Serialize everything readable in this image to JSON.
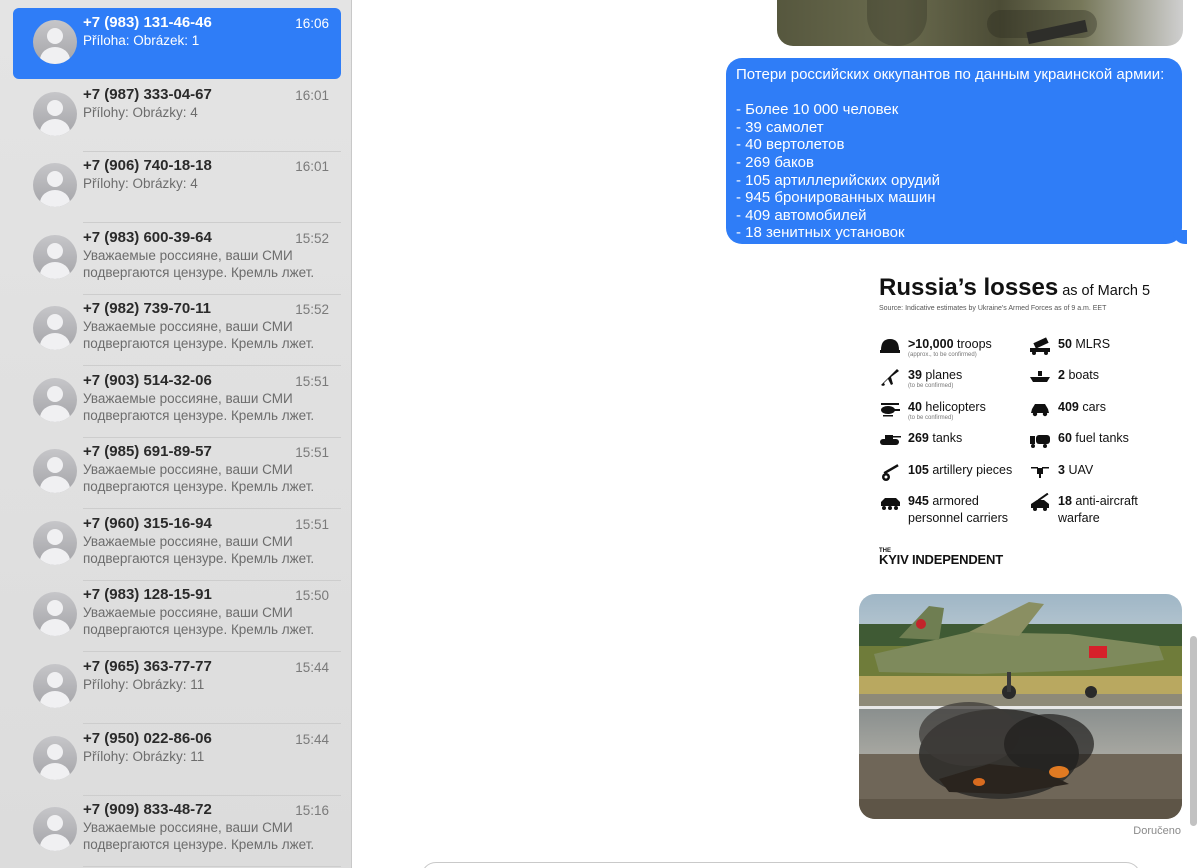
{
  "conversations": [
    {
      "name": "+7 (983) 131-46-46",
      "time": "16:06",
      "preview": "Příloha: Obrázek: 1",
      "selected": true
    },
    {
      "name": "+7 (987) 333-04-67",
      "time": "16:01",
      "preview": "Přílohy: Obrázky: 4"
    },
    {
      "name": "+7 (906) 740-18-18",
      "time": "16:01",
      "preview": "Přílohy: Obrázky: 4"
    },
    {
      "name": "+7 (983) 600-39-64",
      "time": "15:52",
      "preview": "Уважаемые россияне, ваши СМИ подвергаются цензуре.  Кремль лжет."
    },
    {
      "name": "+7 (982) 739-70-11",
      "time": "15:52",
      "preview": "Уважаемые россияне, ваши СМИ подвергаются цензуре.  Кремль лжет."
    },
    {
      "name": "+7 (903) 514-32-06",
      "time": "15:51",
      "preview": "Уважаемые россияне, ваши СМИ подвергаются цензуре.  Кремль лжет."
    },
    {
      "name": "+7 (985) 691-89-57",
      "time": "15:51",
      "preview": "Уважаемые россияне, ваши СМИ подвергаются цензуре.  Кремль лжет."
    },
    {
      "name": "+7 (960) 315-16-94",
      "time": "15:51",
      "preview": "Уважаемые россияне, ваши СМИ подвергаются цензуре.  Кремль лжет."
    },
    {
      "name": "+7 (983) 128-15-91",
      "time": "15:50",
      "preview": "Уважаемые россияне, ваши СМИ подвергаются цензуре.  Кремль лжет."
    },
    {
      "name": "+7 (965) 363-77-77",
      "time": "15:44",
      "preview": "Přílohy: Obrázky: 11"
    },
    {
      "name": "+7 (950) 022-86-06",
      "time": "15:44",
      "preview": "Přílohy: Obrázky: 11"
    },
    {
      "name": "+7 (909) 833-48-72",
      "time": "15:16",
      "preview": "Уважаемые россияне, ваши СМИ подвергаются цензуре.  Кремль лжет."
    }
  ],
  "message": {
    "lines": [
      "Потери российских оккупантов по данным украинской армии:",
      "",
      "- Более 10 000 человек",
      "- 39 самолет",
      "- 40 вертолетов",
      "- 269 баков",
      "- 105 артиллерийских орудий",
      "- 945 бронированных машин",
      "- 409 автомобилей",
      "- 18 зенитных установок"
    ]
  },
  "infographic": {
    "title": "Russia’s losses",
    "as_of": "as of March 5",
    "source": "Source: Indicative estimates by Ukraine's Armed Forces as of 9 a.m. EET",
    "left": [
      {
        "icon": "helmet-icon",
        "value": ">10,000",
        "label": "troops",
        "note": "(approx., to be confirmed)"
      },
      {
        "icon": "plane-icon",
        "value": "39",
        "label": "planes",
        "note": "(to be confirmed)"
      },
      {
        "icon": "helicopter-icon",
        "value": "40",
        "label": "helicopters",
        "note": "(to be confirmed)"
      },
      {
        "icon": "tank-icon",
        "value": "269",
        "label": "tanks",
        "note": ""
      },
      {
        "icon": "artillery-icon",
        "value": "105",
        "label": "artillery pieces",
        "note": ""
      },
      {
        "icon": "apc-icon",
        "value": "945",
        "label": "armored",
        "label2": "personnel carriers",
        "note": ""
      }
    ],
    "right": [
      {
        "icon": "mlrs-icon",
        "value": "50",
        "label": "MLRS"
      },
      {
        "icon": "boat-icon",
        "value": "2",
        "label": "boats"
      },
      {
        "icon": "car-icon",
        "value": "409",
        "label": "cars"
      },
      {
        "icon": "fuel-tank-icon",
        "value": "60",
        "label": "fuel tanks"
      },
      {
        "icon": "drone-icon",
        "value": "3",
        "label": "UAV"
      },
      {
        "icon": "anti-aircraft-icon",
        "value": "18",
        "label": "anti-aircraft",
        "label2": "warfare"
      }
    ],
    "brand_the": "THE",
    "brand": "KYIV INDEPENDENT"
  },
  "status": "Doručeno",
  "colors": {
    "accent": "#2f7df7",
    "sidebar": "#e0e0e0"
  }
}
